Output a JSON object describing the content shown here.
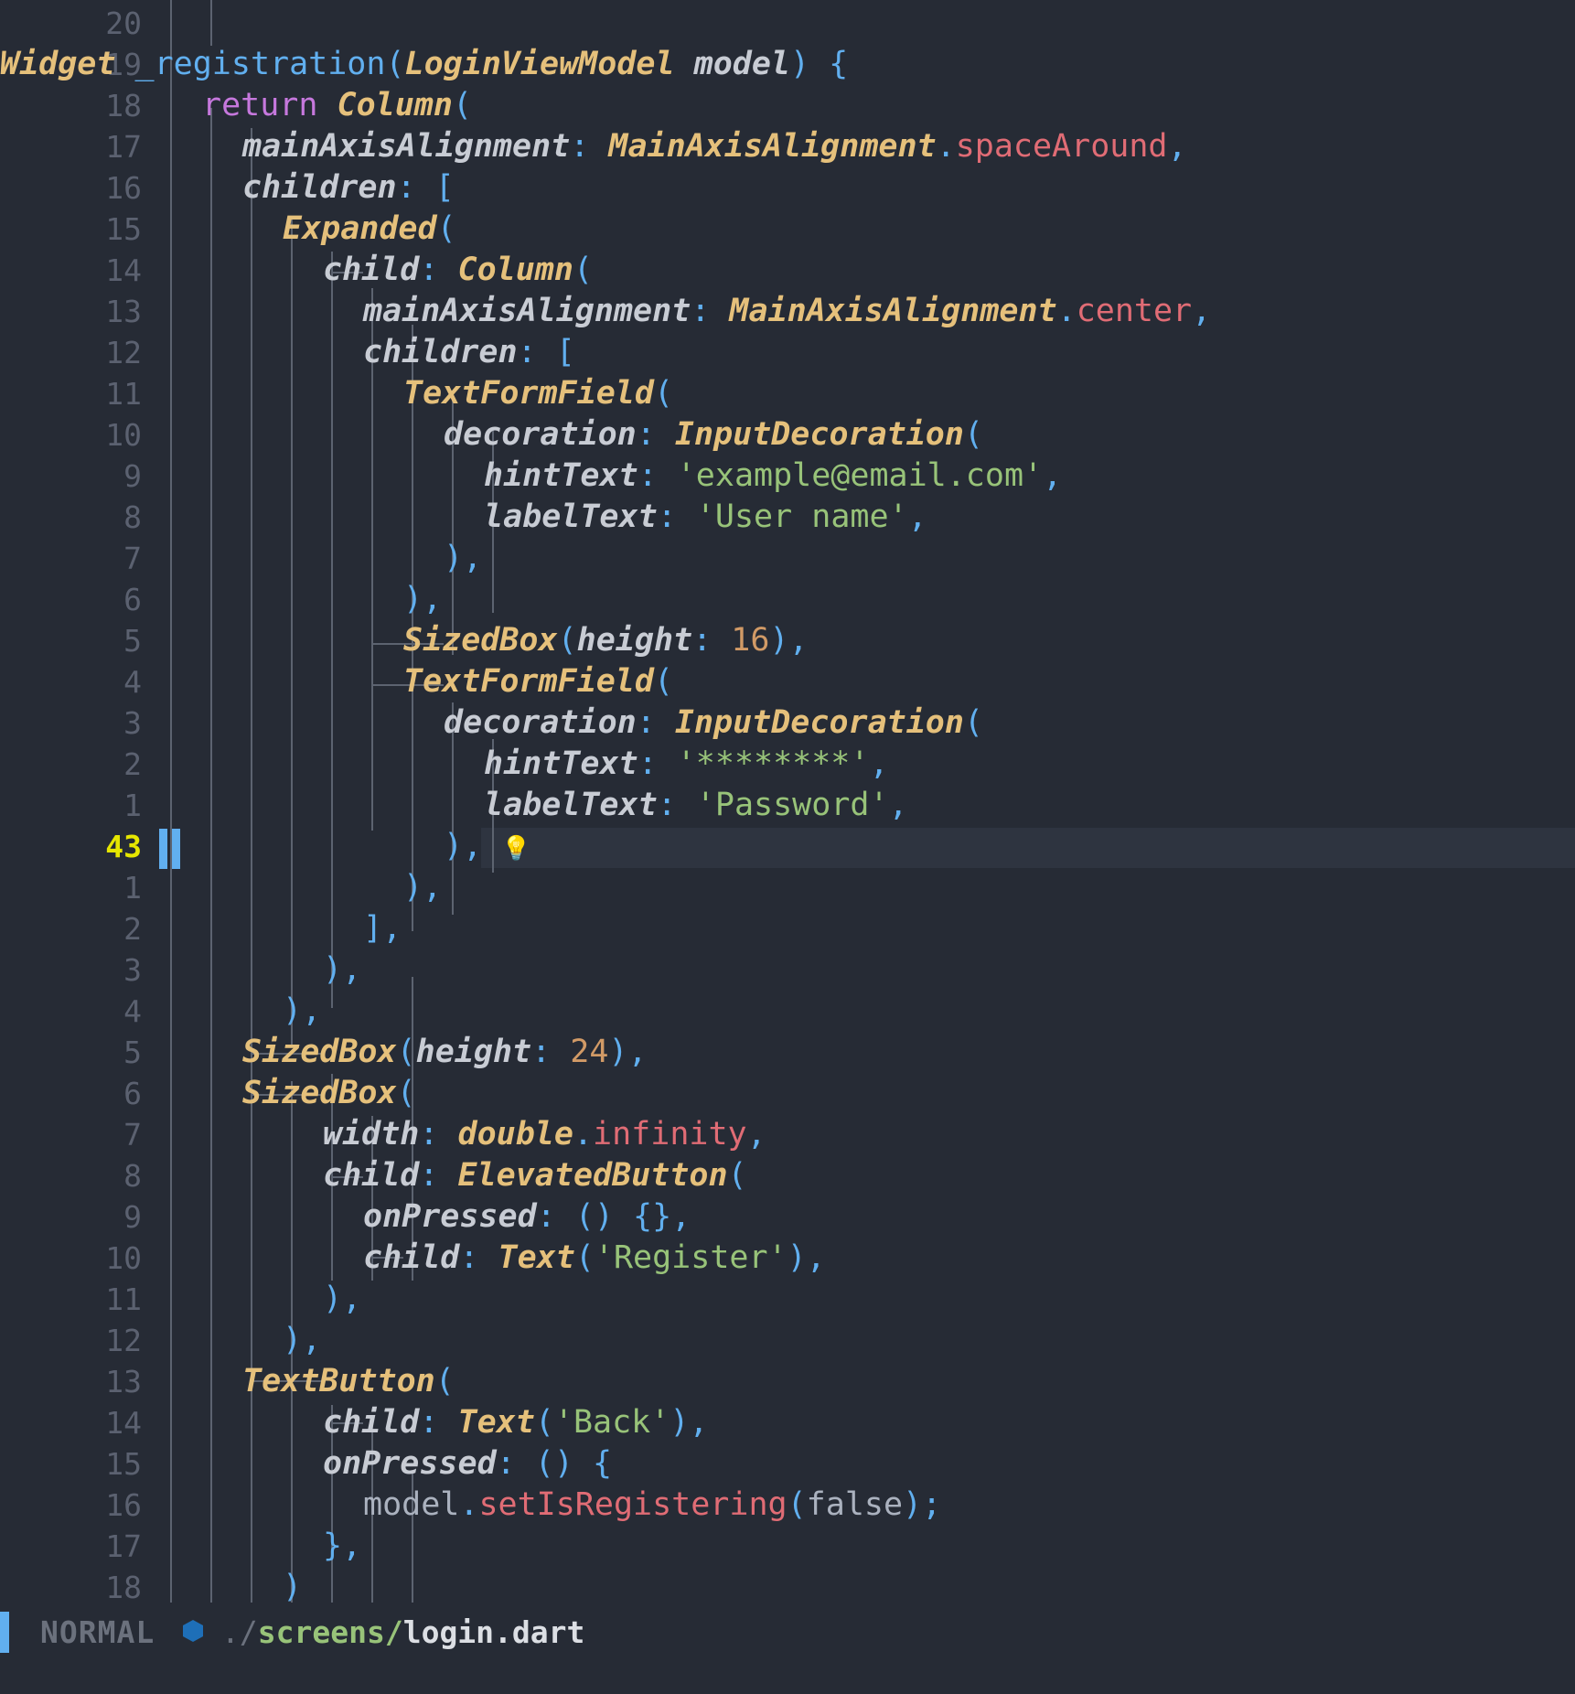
{
  "gutter": {
    "numbers": [
      "20",
      "19",
      "18",
      "17",
      "16",
      "15",
      "14",
      "13",
      "12",
      "11",
      "10",
      "9",
      "8",
      "7",
      "6",
      "5",
      "4",
      "3",
      "2",
      "1",
      "43",
      "1",
      "2",
      "3",
      "4",
      "5",
      "6",
      "7",
      "8",
      "9",
      "10",
      "11",
      "12",
      "13",
      "14",
      "15",
      "16",
      "17",
      "18"
    ],
    "current_line": "43"
  },
  "code_lines": [
    [],
    [
      [
        "Widget",
        "type"
      ],
      [
        " ",
        "plain"
      ],
      [
        "_registration",
        "fn"
      ],
      [
        "(",
        "punc"
      ],
      [
        "LoginViewModel",
        "type"
      ],
      [
        " ",
        "plain"
      ],
      [
        "model",
        "param"
      ],
      [
        ") {",
        "punc"
      ]
    ],
    [
      [
        "return",
        "kw"
      ],
      [
        " ",
        "plain"
      ],
      [
        "Column",
        "type"
      ],
      [
        "(",
        "punc"
      ]
    ],
    [
      [
        "mainAxisAlignment",
        "param"
      ],
      [
        ": ",
        "punc"
      ],
      [
        "MainAxisAlignment",
        "type"
      ],
      [
        ".",
        "punc"
      ],
      [
        "spaceAround",
        "enum"
      ],
      [
        ",",
        "punc"
      ]
    ],
    [
      [
        "children",
        "param"
      ],
      [
        ": [",
        "punc"
      ]
    ],
    [
      [
        "Expanded",
        "type"
      ],
      [
        "(",
        "punc"
      ]
    ],
    [
      [
        "child",
        "param"
      ],
      [
        ": ",
        "punc"
      ],
      [
        "Column",
        "type"
      ],
      [
        "(",
        "punc"
      ]
    ],
    [
      [
        "mainAxisAlignment",
        "param"
      ],
      [
        ": ",
        "punc"
      ],
      [
        "MainAxisAlignment",
        "type"
      ],
      [
        ".",
        "punc"
      ],
      [
        "center",
        "enum"
      ],
      [
        ",",
        "punc"
      ]
    ],
    [
      [
        "children",
        "param"
      ],
      [
        ": [",
        "punc"
      ]
    ],
    [
      [
        "TextFormField",
        "type"
      ],
      [
        "(",
        "punc"
      ]
    ],
    [
      [
        "decoration",
        "param"
      ],
      [
        ": ",
        "punc"
      ],
      [
        "InputDecoration",
        "type"
      ],
      [
        "(",
        "punc"
      ]
    ],
    [
      [
        "hintText",
        "param"
      ],
      [
        ": ",
        "punc"
      ],
      [
        "'example@email.com'",
        "str"
      ],
      [
        ",",
        "punc"
      ]
    ],
    [
      [
        "labelText",
        "param"
      ],
      [
        ": ",
        "punc"
      ],
      [
        "'User name'",
        "str"
      ],
      [
        ",",
        "punc"
      ]
    ],
    [
      [
        "),",
        "punc"
      ]
    ],
    [
      [
        "),",
        "punc"
      ]
    ],
    [
      [
        "SizedBox",
        "type"
      ],
      [
        "(",
        "punc"
      ],
      [
        "height",
        "param"
      ],
      [
        ": ",
        "punc"
      ],
      [
        "16",
        "num"
      ],
      [
        "),",
        "punc"
      ]
    ],
    [
      [
        "TextFormField",
        "type"
      ],
      [
        "(",
        "punc"
      ]
    ],
    [
      [
        "decoration",
        "param"
      ],
      [
        ": ",
        "punc"
      ],
      [
        "InputDecoration",
        "type"
      ],
      [
        "(",
        "punc"
      ]
    ],
    [
      [
        "hintText",
        "param"
      ],
      [
        ": ",
        "punc"
      ],
      [
        "'********'",
        "str"
      ],
      [
        ",",
        "punc"
      ]
    ],
    [
      [
        "labelText",
        "param"
      ],
      [
        ": ",
        "punc"
      ],
      [
        "'Password'",
        "str"
      ],
      [
        ",",
        "punc"
      ]
    ],
    [
      [
        "), ",
        "punc"
      ]
    ],
    [
      [
        "),",
        "punc"
      ]
    ],
    [
      [
        "],",
        "punc"
      ]
    ],
    [
      [
        "),",
        "punc"
      ]
    ],
    [
      [
        "),",
        "punc"
      ]
    ],
    [
      [
        "SizedBox",
        "type"
      ],
      [
        "(",
        "punc"
      ],
      [
        "height",
        "param"
      ],
      [
        ": ",
        "punc"
      ],
      [
        "24",
        "num"
      ],
      [
        "),",
        "punc"
      ]
    ],
    [
      [
        "SizedBox",
        "type"
      ],
      [
        "(",
        "punc"
      ]
    ],
    [
      [
        "width",
        "param"
      ],
      [
        ": ",
        "punc"
      ],
      [
        "double",
        "type"
      ],
      [
        ".",
        "punc"
      ],
      [
        "infinity",
        "enum"
      ],
      [
        ",",
        "punc"
      ]
    ],
    [
      [
        "child",
        "param"
      ],
      [
        ": ",
        "punc"
      ],
      [
        "ElevatedButton",
        "type"
      ],
      [
        "(",
        "punc"
      ]
    ],
    [
      [
        "onPressed",
        "param"
      ],
      [
        ": () {},",
        "punc"
      ]
    ],
    [
      [
        "child",
        "param"
      ],
      [
        ": ",
        "punc"
      ],
      [
        "Text",
        "type"
      ],
      [
        "(",
        "punc"
      ],
      [
        "'Register'",
        "str"
      ],
      [
        "),",
        "punc"
      ]
    ],
    [
      [
        "),",
        "punc"
      ]
    ],
    [
      [
        "),",
        "punc"
      ]
    ],
    [
      [
        "TextButton",
        "type"
      ],
      [
        "(",
        "punc"
      ]
    ],
    [
      [
        "child",
        "param"
      ],
      [
        ": ",
        "punc"
      ],
      [
        "Text",
        "type"
      ],
      [
        "(",
        "punc"
      ],
      [
        "'Back'",
        "str"
      ],
      [
        "),",
        "punc"
      ]
    ],
    [
      [
        "onPressed",
        "param"
      ],
      [
        ": () {",
        "punc"
      ]
    ],
    [
      [
        "model",
        "plain"
      ],
      [
        ".",
        "punc"
      ],
      [
        "setIsRegistering",
        "enum"
      ],
      [
        "(",
        "punc"
      ],
      [
        "false",
        "plain"
      ],
      [
        ");",
        "punc"
      ]
    ],
    [
      [
        "},",
        "punc"
      ]
    ],
    [
      [
        ")",
        "punc"
      ]
    ]
  ],
  "statusline": {
    "mode": "NORMAL",
    "path_prefix": "./",
    "path_dir": "screens/",
    "path_file": "login.dart"
  },
  "icons": {
    "lightbulb": "lightbulb-icon",
    "file": "dart-file-icon"
  },
  "colors": {
    "background": "#262b35",
    "keyword": "#c678dd",
    "type": "#e5c07b",
    "string": "#98c379",
    "number": "#d19a66",
    "accent": "#61afef",
    "enum": "#e06c75",
    "current_line_number": "#e6e600"
  }
}
